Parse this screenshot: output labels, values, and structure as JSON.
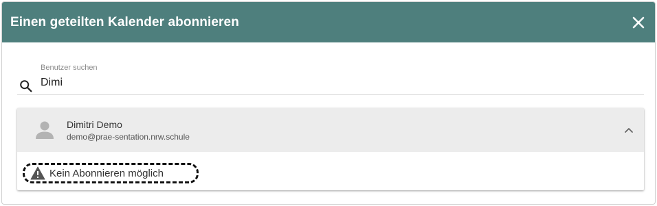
{
  "dialog": {
    "title": "Einen geteilten Kalender abonnieren",
    "close_icon": "close-icon"
  },
  "search": {
    "label": "Benutzer suchen",
    "value": "Dimi",
    "icon": "search-icon"
  },
  "result": {
    "name": "Dimitri Demo",
    "email": "demo@prae-sentation.nrw.schule",
    "avatar_icon": "person-icon",
    "expand_icon": "chevron-up-icon",
    "warning_icon": "warning-icon",
    "warning_text": "Kein Abonnieren möglich"
  },
  "colors": {
    "header_bg": "#4e7f7d",
    "result_header_bg": "#ececec"
  }
}
